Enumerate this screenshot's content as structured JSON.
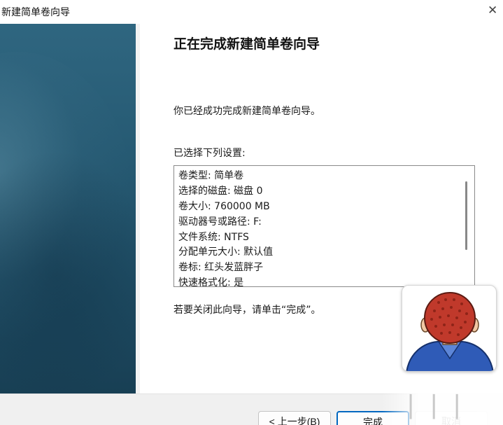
{
  "window": {
    "title": "新建简单卷向导",
    "close_icon": "close-icon"
  },
  "wizard": {
    "heading": "正在完成新建简单卷向导",
    "success_message": "你已经成功完成新建简单卷向导。",
    "settings_label": "已选择下列设置:",
    "settings": [
      "卷类型: 简单卷",
      "选择的磁盘: 磁盘 0",
      "卷大小: 760000 MB",
      "驱动器号或路径: F:",
      "文件系统: NTFS",
      "分配单元大小: 默认值",
      "卷标: 红头发蓝胖子",
      "快速格式化: 是"
    ],
    "close_hint": "若要关闭此向导，请单击“完成”。"
  },
  "buttons": {
    "back": "< 上一步(B)",
    "finish": "完成",
    "cancel": "取消"
  },
  "colors": {
    "banner": "#265a73",
    "finish_border": "#0067c0",
    "avatar_hair": "#c0392b",
    "avatar_shirt": "#2f5bb7"
  }
}
